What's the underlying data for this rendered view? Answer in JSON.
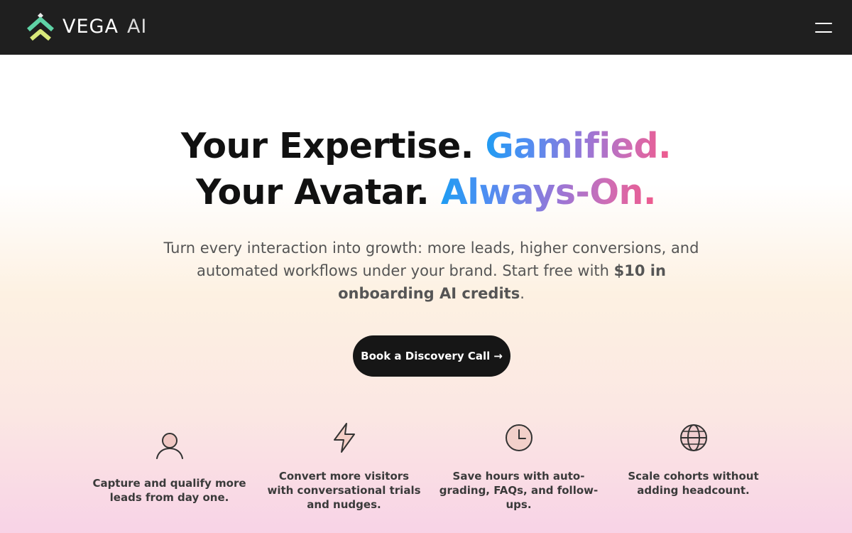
{
  "navbar": {
    "logo_text": "VEGA",
    "logo_ai": "AI",
    "logo_icon": "chevron-up-double-icon",
    "menu_icon": "hamburger-menu-icon"
  },
  "hero": {
    "line1_plain": "Your Expertise.",
    "line1_accent": "Gamified.",
    "line2_plain": "Your Avatar.",
    "line2_accent": "Always-On.",
    "subtitle_prefix": "Turn every interaction into growth: more leads, higher conversions, and automated workflows under your brand. Start free with ",
    "subtitle_bold": "$10 in onboarding AI credits",
    "subtitle_suffix": ".",
    "cta_label": "Book a Discovery Call",
    "cta_arrow": "→"
  },
  "features": [
    {
      "icon": "user-icon",
      "text": "Capture and qualify more leads from day one."
    },
    {
      "icon": "lightning-icon",
      "text": "Convert more visitors with conversational trials and nudges."
    },
    {
      "icon": "clock-icon",
      "text": "Save hours with auto-grading, FAQs, and follow-ups."
    },
    {
      "icon": "globe-icon",
      "text": "Scale cohorts without adding headcount."
    }
  ],
  "colors": {
    "navbar_bg": "#1f1f1f",
    "accent_gradient": [
      "#1f9cf2",
      "#9a76d6",
      "#ef5a8c"
    ],
    "logo_green": "#5fd3a6",
    "logo_yellow": "#d8e87a"
  }
}
